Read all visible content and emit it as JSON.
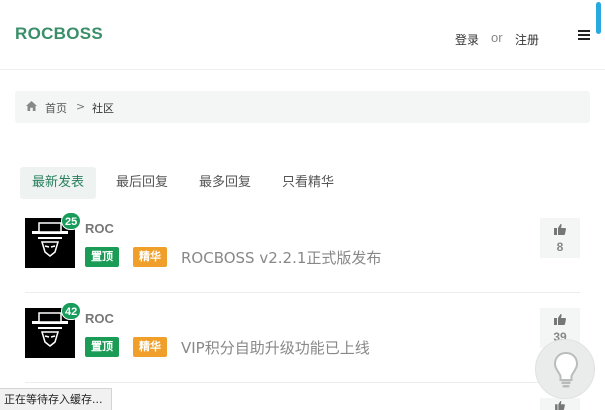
{
  "header": {
    "logo": "ROCBOSS",
    "login_label": "登录",
    "or_label": "or",
    "register_label": "注册",
    "menu_icon": "hamburger-menu-icon"
  },
  "breadcrumb": {
    "home_icon": "home-icon",
    "home_label": "首页",
    "separator": ">",
    "current_label": "社区"
  },
  "tabs": [
    {
      "label": "最新发表",
      "active": true
    },
    {
      "label": "最后回复",
      "active": false
    },
    {
      "label": "最多回复",
      "active": false
    },
    {
      "label": "只看精华",
      "active": false
    }
  ],
  "topics": [
    {
      "author": "ROC",
      "badge_count": "25",
      "tag_top": "置顶",
      "tag_best": "精华",
      "title": "ROCBOSS v2.2.1正式版发布",
      "votes": "8"
    },
    {
      "author": "ROC",
      "badge_count": "42",
      "tag_top": "置顶",
      "tag_best": "精华",
      "title": "VIP积分自助升级功能已上线",
      "votes": "39"
    }
  ],
  "floating": {
    "icon": "lightbulb-icon"
  },
  "status": {
    "text": "正在等待存入缓存..."
  },
  "colors": {
    "brand": "#3a8f6a",
    "tag_top": "#1a9b56",
    "tag_best": "#f0a02a",
    "badge": "#179c5b",
    "scrollbar": "#2aa8e0"
  }
}
